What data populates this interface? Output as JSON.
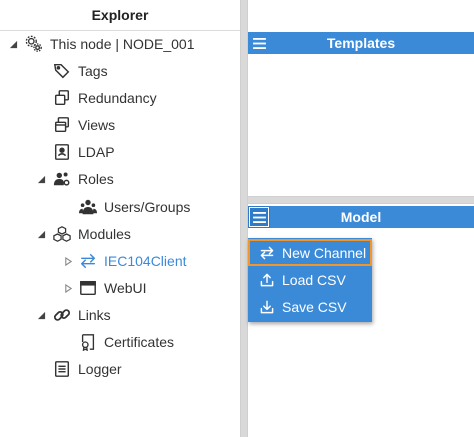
{
  "explorer": {
    "title": "Explorer",
    "items": [
      {
        "label": "This node | NODE_001"
      },
      {
        "label": "Tags"
      },
      {
        "label": "Redundancy"
      },
      {
        "label": "Views"
      },
      {
        "label": "LDAP"
      },
      {
        "label": "Roles"
      },
      {
        "label": "Users/Groups"
      },
      {
        "label": "Modules"
      },
      {
        "label": "IEC104Client"
      },
      {
        "label": "WebUI"
      },
      {
        "label": "Links"
      },
      {
        "label": "Certificates"
      },
      {
        "label": "Logger"
      }
    ]
  },
  "templates_panel": {
    "title": "Templates"
  },
  "model_panel": {
    "title": "Model"
  },
  "context_menu": {
    "items": [
      {
        "label": "New Channel"
      },
      {
        "label": "Load CSV"
      },
      {
        "label": "Save CSV"
      }
    ]
  },
  "colors": {
    "accent": "#3b8ad8",
    "highlight_outline": "#f0962d",
    "active_item_text": "#3b8ad8"
  }
}
